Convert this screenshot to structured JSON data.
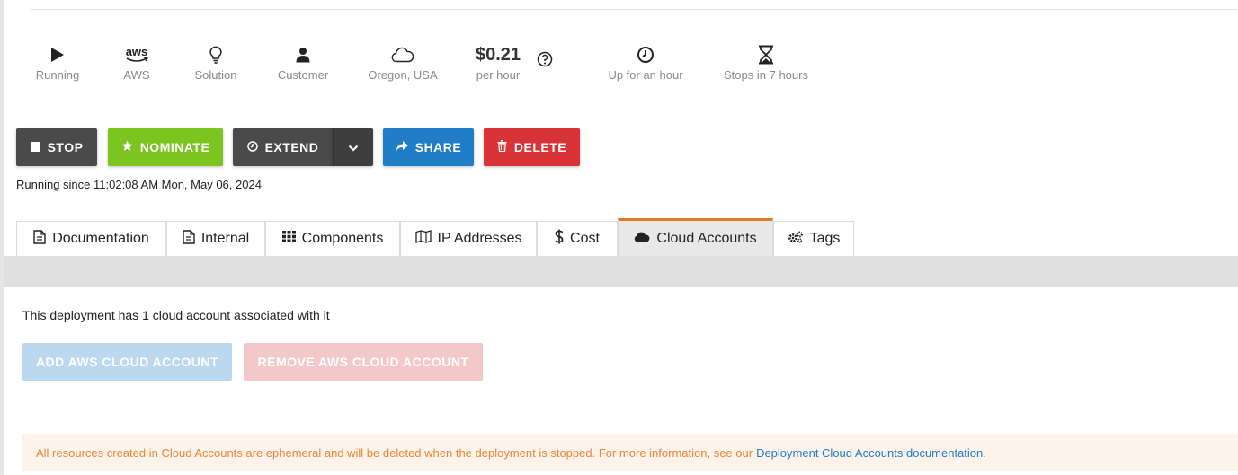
{
  "status": {
    "state": "Running",
    "provider": "AWS",
    "provider_logo_text": "aws",
    "type": "Solution",
    "audience": "Customer",
    "region": "Oregon, USA",
    "price": "$0.21",
    "price_unit": "per hour",
    "uptime": "Up for an hour",
    "stops_in": "Stops in 7 hours"
  },
  "actions": {
    "stop": "STOP",
    "nominate": "NOMINATE",
    "extend": "EXTEND",
    "share": "SHARE",
    "delete": "DELETE"
  },
  "running_since": "Running since 11:02:08 AM Mon, May 06, 2024",
  "tabs": [
    {
      "label": "Documentation",
      "icon": "document-icon"
    },
    {
      "label": "Internal",
      "icon": "document-icon"
    },
    {
      "label": "Components",
      "icon": "grid-icon"
    },
    {
      "label": "IP Addresses",
      "icon": "map-icon"
    },
    {
      "label": "Cost",
      "icon": "dollar-icon"
    },
    {
      "label": "Cloud Accounts",
      "icon": "cloud-icon",
      "active": true
    },
    {
      "label": "Tags",
      "icon": "gears-icon"
    }
  ],
  "cloud_accounts": {
    "summary": "This deployment has 1 cloud account associated with it",
    "add_button": "ADD AWS CLOUD ACCOUNT",
    "remove_button": "REMOVE AWS CLOUD ACCOUNT",
    "notice_text": "All resources created in Cloud Accounts are ephemeral and will be deleted when the deployment is stopped. For more information, see our",
    "notice_link": "Deployment Cloud Accounts documentation",
    "notice_end": "."
  },
  "colors": {
    "stop": "#4a4a4a",
    "nominate": "#7cc520",
    "share": "#1f7ec5",
    "delete": "#d93338",
    "active_tab_accent": "#e07b28",
    "notice_text": "#e6883a"
  }
}
